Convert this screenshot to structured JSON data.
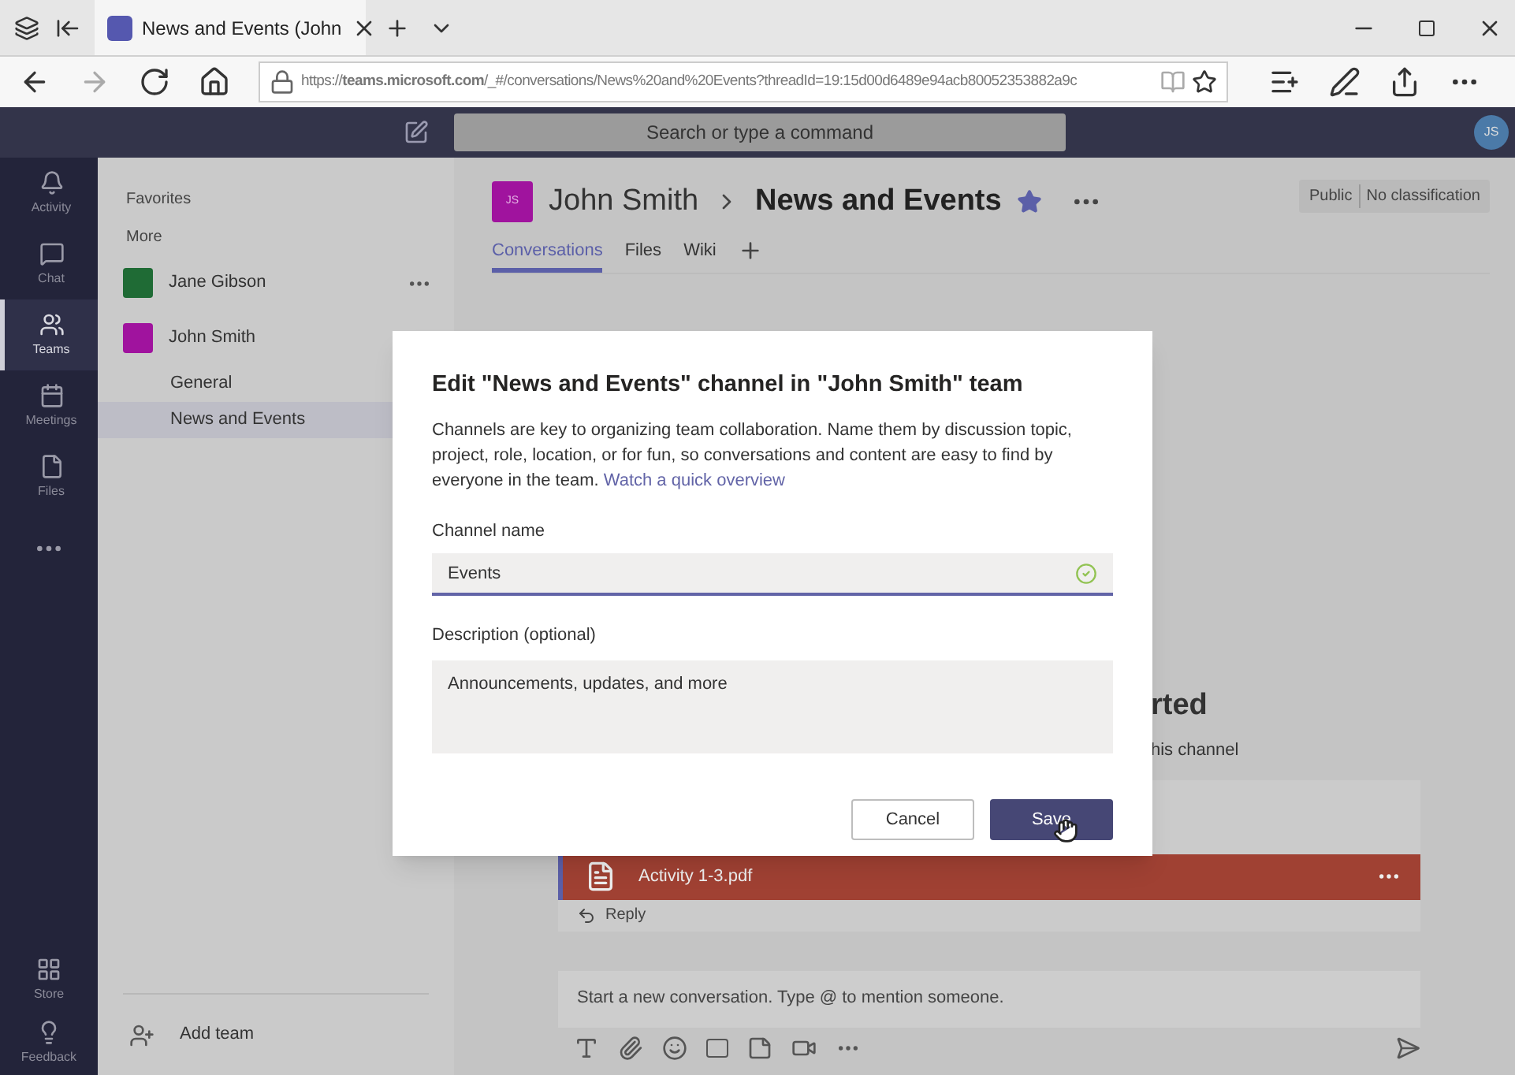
{
  "browser": {
    "tab_title": "News and Events (John",
    "url": "https://**teams.microsoft.com**/_#/conversations/News%20and%20Events?threadId=19:15d00d6489e94acb80052353882a9c"
  },
  "header": {
    "search_placeholder": "Search or type a command",
    "avatar": "JS"
  },
  "rail": [
    {
      "label": "Activity",
      "selected": false
    },
    {
      "label": "Chat",
      "selected": false
    },
    {
      "label": "Teams",
      "selected": true
    },
    {
      "label": "Meetings",
      "selected": false
    },
    {
      "label": "Files",
      "selected": false
    }
  ],
  "rail_bottom": [
    {
      "label": "Store"
    },
    {
      "label": "Feedback"
    }
  ],
  "sidebar": {
    "sections": [
      "Favorites",
      "More"
    ],
    "teams": [
      {
        "name": "Jane Gibson",
        "color": "#1f6b35"
      },
      {
        "name": "John Smith",
        "color": "#a0139e",
        "children": [
          {
            "name": "General",
            "selected": false
          },
          {
            "name": "News and Events",
            "selected": true
          }
        ]
      }
    ],
    "add_team": "Add team"
  },
  "channel": {
    "avatar": "JS",
    "team": "John Smith",
    "name": "News and Events",
    "badges": [
      "Public",
      "No classification"
    ],
    "tabs": [
      {
        "label": "Conversations",
        "selected": true
      },
      {
        "label": "Files",
        "selected": false
      },
      {
        "label": "Wiki",
        "selected": false
      }
    ]
  },
  "background": {
    "heading_fragment": "rted",
    "subtitle_fragment": "his channel",
    "attachment": "Activity 1-3.pdf",
    "reply": "Reply",
    "compose_placeholder": "Start a new conversation. Type @ to mention someone."
  },
  "dialog": {
    "title": "Edit \"News and Events\" channel in \"John Smith\" team",
    "description": "Channels are key to organizing team collaboration. Name them by discussion topic, project, role, location, or for fun, so conversations and content are easy to find by everyone in the team.",
    "link": "Watch a quick overview",
    "name_label": "Channel name",
    "name_value": "Events",
    "name_valid": true,
    "description_label": "Description (optional)",
    "description_value": "Announcements, updates, and more",
    "buttons": [
      {
        "label": "Cancel",
        "kind": "secondary"
      },
      {
        "label": "Save",
        "kind": "primary"
      }
    ]
  }
}
